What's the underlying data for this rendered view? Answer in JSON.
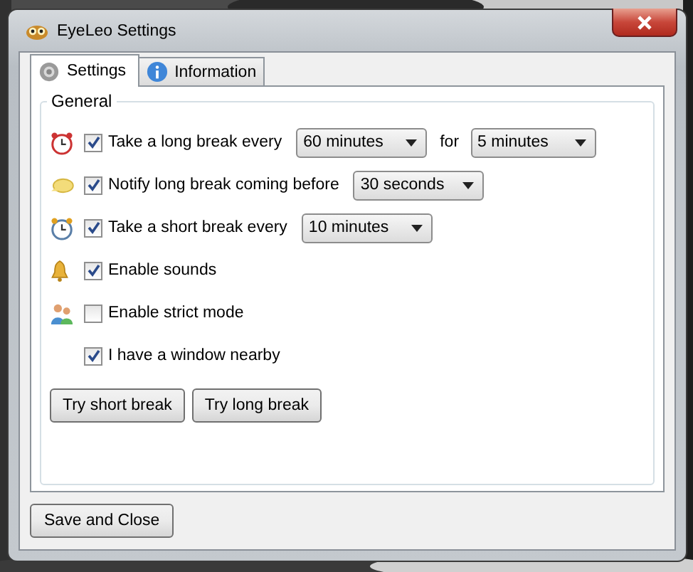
{
  "window": {
    "title": "EyeLeo Settings"
  },
  "tabs": [
    {
      "label": "Settings",
      "selected": true
    },
    {
      "label": "Information",
      "selected": false
    }
  ],
  "group": {
    "title": "General"
  },
  "settings": [
    {
      "label": "Take a long break every",
      "checked": true,
      "parts": [
        {
          "kind": "select",
          "value": "60 minutes"
        },
        {
          "kind": "text",
          "text": "for"
        },
        {
          "kind": "select",
          "value": "5 minutes"
        }
      ]
    },
    {
      "label": "Notify long break coming before",
      "checked": true,
      "parts": [
        {
          "kind": "select",
          "value": "30 seconds"
        }
      ]
    },
    {
      "label": "Take a short break every",
      "checked": true,
      "parts": [
        {
          "kind": "select",
          "value": "10 minutes"
        }
      ]
    },
    {
      "label": "Enable sounds",
      "checked": true
    },
    {
      "label": "Enable strict mode",
      "checked": false
    },
    {
      "label": "I have a window nearby",
      "checked": true
    }
  ],
  "try_buttons": [
    "Try short break",
    "Try long break"
  ],
  "footer_button": "Save and Close"
}
